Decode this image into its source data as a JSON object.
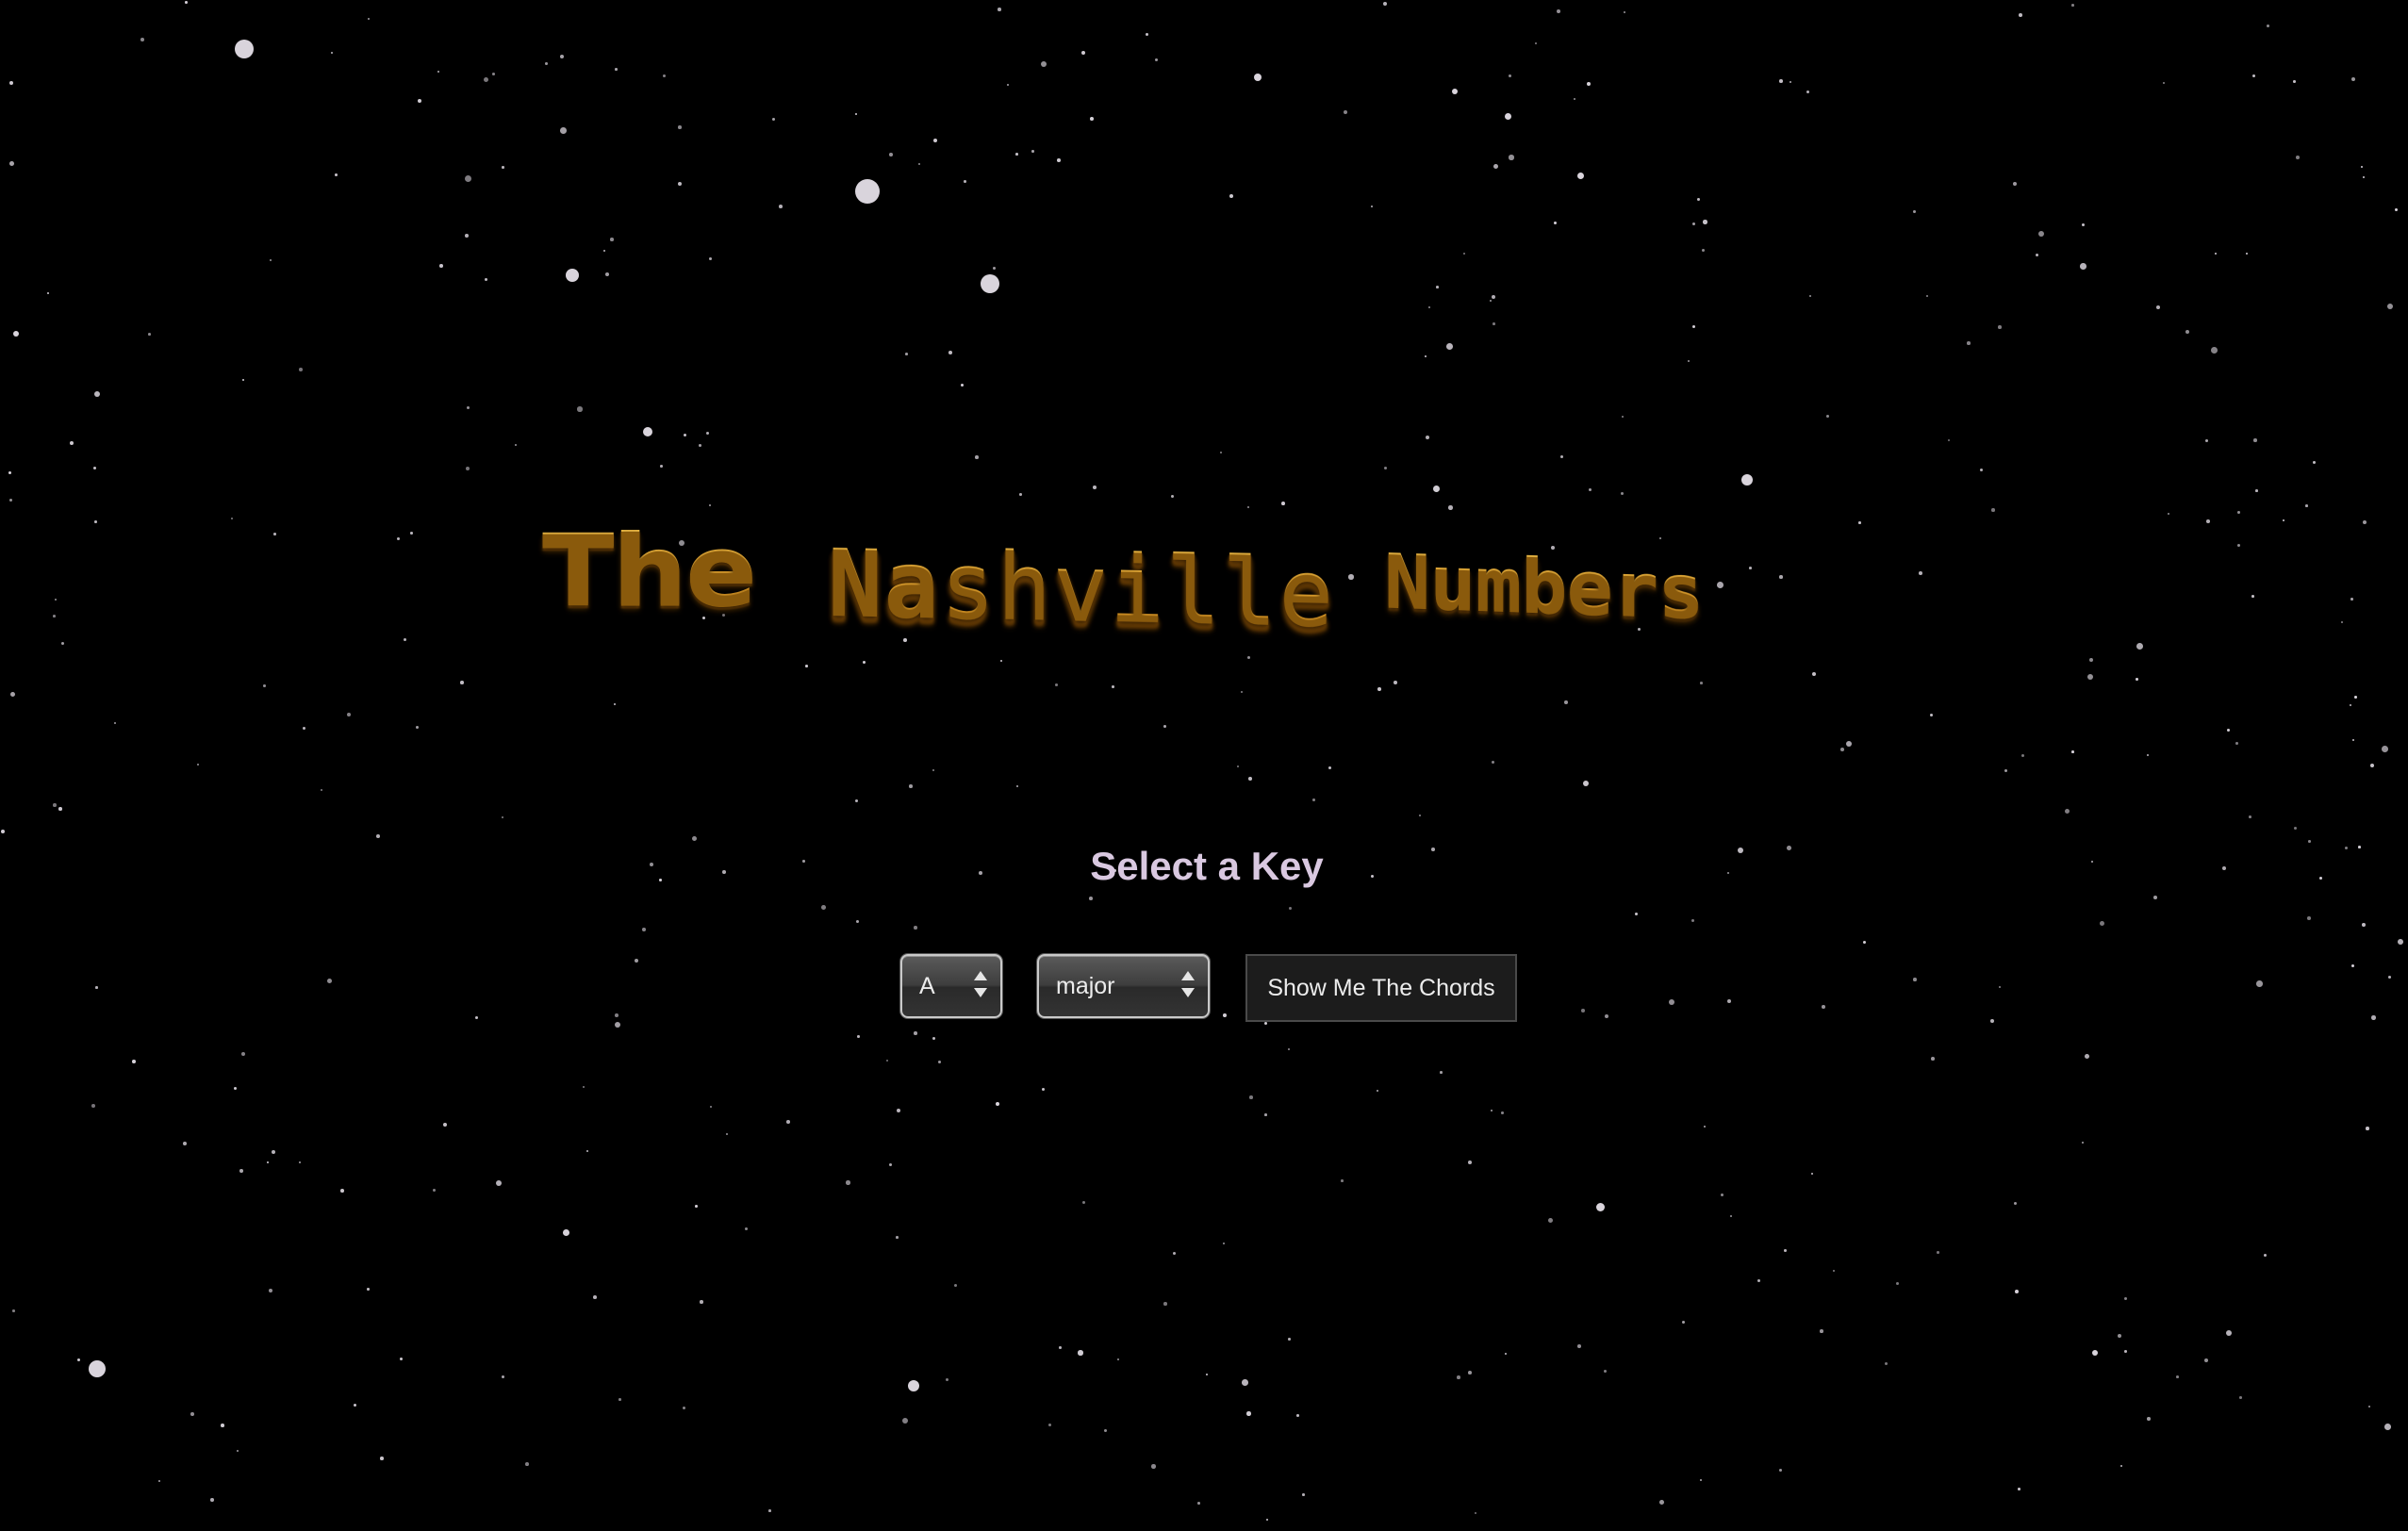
{
  "app": {
    "title": {
      "word1": "The",
      "word2_head": "Na",
      "word2_tail": "shville",
      "word3": "Numbers"
    },
    "accent_color": "#e6a52a",
    "background_color": "#000000"
  },
  "key_selector": {
    "heading": "Select a Key",
    "key_value": "A",
    "mode_value": "major",
    "submit_label": "Show Me The Chords"
  },
  "icons": {
    "select_arrows": "up-down-chevron-icon"
  }
}
